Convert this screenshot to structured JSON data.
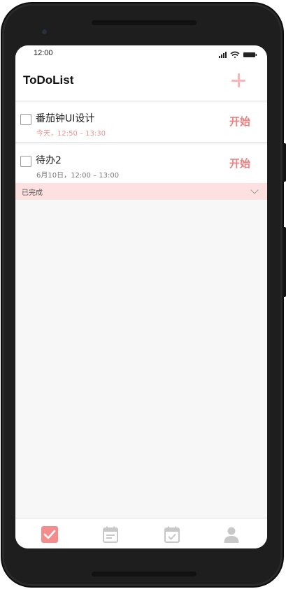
{
  "statusbar": {
    "time": "12:00"
  },
  "header": {
    "title": "ToDoList",
    "add_icon": "plus-icon"
  },
  "todos": [
    {
      "title": "番茄钟UI设计",
      "time": "今天，12:50 – 13:30",
      "action": "开始"
    },
    {
      "title": "待办2",
      "time": "6月10日，12:00 – 13:00",
      "action": "开始"
    }
  ],
  "completed": {
    "label": "已完成",
    "icon": "chevron-down-icon"
  },
  "tabbar": {
    "tabs": [
      {
        "name": "todo",
        "icon": "checkbox-icon",
        "active": true
      },
      {
        "name": "calendar",
        "icon": "calendar-icon",
        "active": false
      },
      {
        "name": "calendar-check",
        "icon": "calendar-check-icon",
        "active": false
      },
      {
        "name": "profile",
        "icon": "user-icon",
        "active": false
      }
    ]
  },
  "colors": {
    "accent": "#f08080",
    "accent_light": "#fde1e1",
    "inactive": "#c8c8c8"
  }
}
